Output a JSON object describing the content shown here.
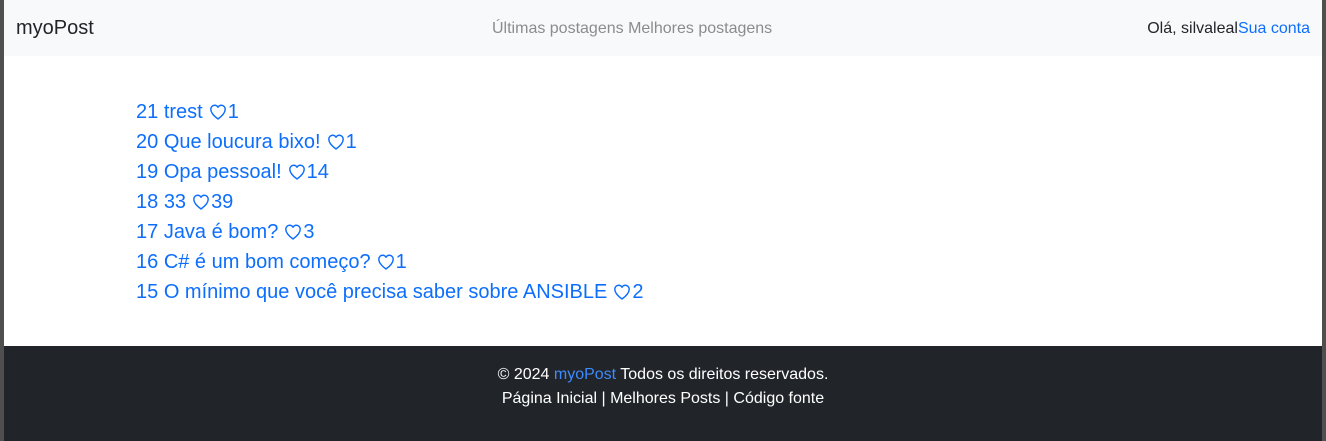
{
  "navbar": {
    "brand": "myoPost",
    "links": [
      "Últimas postagens",
      "Melhores postagens"
    ],
    "greeting": "Olá, silvaleal",
    "account_link": "Sua conta"
  },
  "posts": [
    {
      "id": "21",
      "title": "trest",
      "likes": "1"
    },
    {
      "id": "20",
      "title": "Que loucura bixo!",
      "likes": "1"
    },
    {
      "id": "19",
      "title": "Opa pessoal!",
      "likes": "14"
    },
    {
      "id": "18",
      "title": "33",
      "likes": "39"
    },
    {
      "id": "17",
      "title": "Java é bom?",
      "likes": "3"
    },
    {
      "id": "16",
      "title": "C# é um bom começo?",
      "likes": "1"
    },
    {
      "id": "15",
      "title": "O mínimo que você precisa saber sobre ANSIBLE",
      "likes": "2"
    }
  ],
  "footer": {
    "copyright_prefix": "© 2024",
    "brand": "myoPost",
    "rights": "Todos os direitos reservados.",
    "links": [
      "Página Inicial",
      "Melhores Posts",
      "Código fonte"
    ],
    "separator": "|"
  },
  "colors": {
    "link": "#0d6efd",
    "navbar_bg": "#f8f9fa",
    "footer_bg": "#212529"
  },
  "icons": {
    "like": "heart-icon"
  }
}
